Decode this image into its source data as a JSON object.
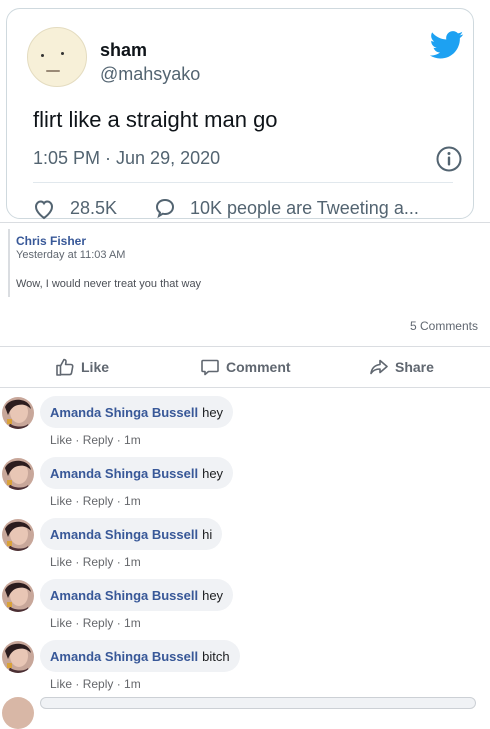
{
  "tweet": {
    "name": "sham",
    "handle": "@mahsyako",
    "text": "flirt like a straight man go",
    "timestamp": "1:05 PM · Jun 29, 2020",
    "likes": "28.5K",
    "talking": "10K people are Tweeting a...",
    "brand_color": "#1da1f2"
  },
  "quote": {
    "author": "Chris Fisher",
    "time": "Yesterday at 11:03 AM",
    "text": "Wow, I would never treat you that way"
  },
  "post": {
    "comments_count": "5 Comments",
    "actions": {
      "like": "Like",
      "comment": "Comment",
      "share": "Share"
    }
  },
  "comments": [
    {
      "author": "Amanda Shinga Bussell",
      "text": "hey",
      "like": "Like",
      "reply": "Reply",
      "time": "1m"
    },
    {
      "author": "Amanda Shinga Bussell",
      "text": "hey",
      "like": "Like",
      "reply": "Reply",
      "time": "1m"
    },
    {
      "author": "Amanda Shinga Bussell",
      "text": "hi",
      "like": "Like",
      "reply": "Reply",
      "time": "1m"
    },
    {
      "author": "Amanda Shinga Bussell",
      "text": "hey",
      "like": "Like",
      "reply": "Reply",
      "time": "1m"
    },
    {
      "author": "Amanda Shinga Bussell",
      "text": "bitch",
      "like": "Like",
      "reply": "Reply",
      "time": "1m"
    }
  ],
  "colors": {
    "fb_link": "#385898",
    "muted": "#606770",
    "bubble": "#f0f2f5"
  }
}
